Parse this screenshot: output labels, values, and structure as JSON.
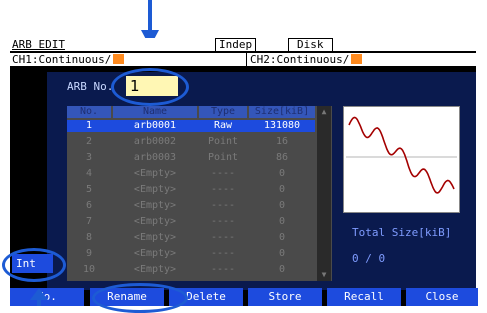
{
  "header": {
    "title": "ARB EDIT",
    "indep_label": "Indep",
    "disk_label": "Disk",
    "ch1_label": "CH1:Continuous/",
    "ch2_label": "CH2:Continuous/"
  },
  "arb_no": {
    "label": "ARB No.",
    "value": "1"
  },
  "table": {
    "columns": [
      "No.",
      "Name",
      "Type",
      "Size[kiB]"
    ],
    "rows": [
      {
        "no": "1",
        "name": "arb0001",
        "type": "Raw",
        "size": "131080",
        "selected": true
      },
      {
        "no": "2",
        "name": "arb0002",
        "type": "Point",
        "size": "16"
      },
      {
        "no": "3",
        "name": "arb0003",
        "type": "Point",
        "size": "86"
      },
      {
        "no": "4",
        "name": "<Empty>",
        "type": "----",
        "size": "0"
      },
      {
        "no": "5",
        "name": "<Empty>",
        "type": "----",
        "size": "0"
      },
      {
        "no": "6",
        "name": "<Empty>",
        "type": "----",
        "size": "0"
      },
      {
        "no": "7",
        "name": "<Empty>",
        "type": "----",
        "size": "0"
      },
      {
        "no": "8",
        "name": "<Empty>",
        "type": "----",
        "size": "0"
      },
      {
        "no": "9",
        "name": "<Empty>",
        "type": "----",
        "size": "0"
      },
      {
        "no": "10",
        "name": "<Empty>",
        "type": "----",
        "size": "0"
      }
    ]
  },
  "summary": {
    "total_label": "Total Size[kiB]",
    "total_value": "0 / 0"
  },
  "left_tab": {
    "label": "Int"
  },
  "softkeys": [
    "No.",
    "Rename",
    "Delete",
    "Store",
    "Recall",
    "Close"
  ],
  "colors": {
    "accent": "#1d4bde",
    "callout": "#1d5bd4",
    "panel": "#0a1a4e",
    "channel_marker": "#ff8a1e"
  }
}
